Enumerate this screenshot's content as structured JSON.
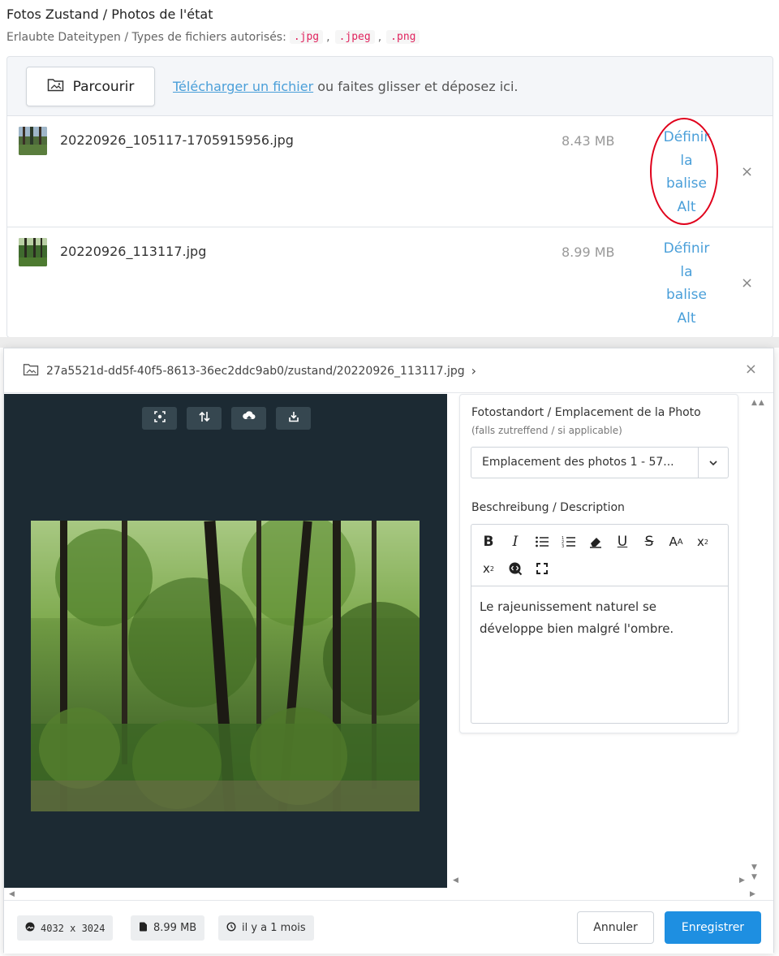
{
  "field": {
    "title": "Fotos Zustand / Photos de l'état",
    "subtitle": "Erlaubte Dateitypen / Types de fichiers autorisés:",
    "types": [
      ".jpg",
      ".jpeg",
      ".png"
    ],
    "type_sep": ","
  },
  "dropzone": {
    "browse_label": "Parcourir",
    "upload_link": "Télécharger un fichier",
    "drop_text": " ou faites glisser et déposez ici."
  },
  "files": [
    {
      "name": "20220926_105117-1705915956.jpg",
      "size": "8.43 MB",
      "alt_action": "Définir la balise Alt",
      "alt_lines": [
        "Définir",
        "la",
        "balise",
        "Alt"
      ],
      "remove": "×"
    },
    {
      "name": "20220926_113117.jpg",
      "size": "8.99 MB",
      "alt_action": "Définir la balise Alt",
      "alt_lines": [
        "Définir",
        "la",
        "balise",
        "Alt"
      ],
      "remove": "×"
    }
  ],
  "modal": {
    "path": "27a5521d-dd5f-40f5-8613-36ec2ddc9ab0/zustand/20220926_113117.jpg",
    "path_chevron": "›",
    "close": "×",
    "location": {
      "label": "Fotostandort / Emplacement de la Photo",
      "hint": "(falls zutreffend / si applicable)",
      "value": "Emplacement des photos 1 - 57..."
    },
    "description": {
      "label": "Beschreibung / Description",
      "text": "Le rajeunissement naturel se développe bien malgré l'ombre."
    },
    "footer": {
      "dimensions": "4032 x 3024",
      "size": "8.99 MB",
      "age": "il y a 1 mois",
      "cancel": "Annuler",
      "save": "Enregistrer"
    }
  },
  "colors": {
    "link": "#4a9fd9",
    "primary": "#1e8fe1",
    "viewer_bg": "#1c2a33",
    "highlight_ring": "#e0001b",
    "code_text": "#e0245e"
  }
}
